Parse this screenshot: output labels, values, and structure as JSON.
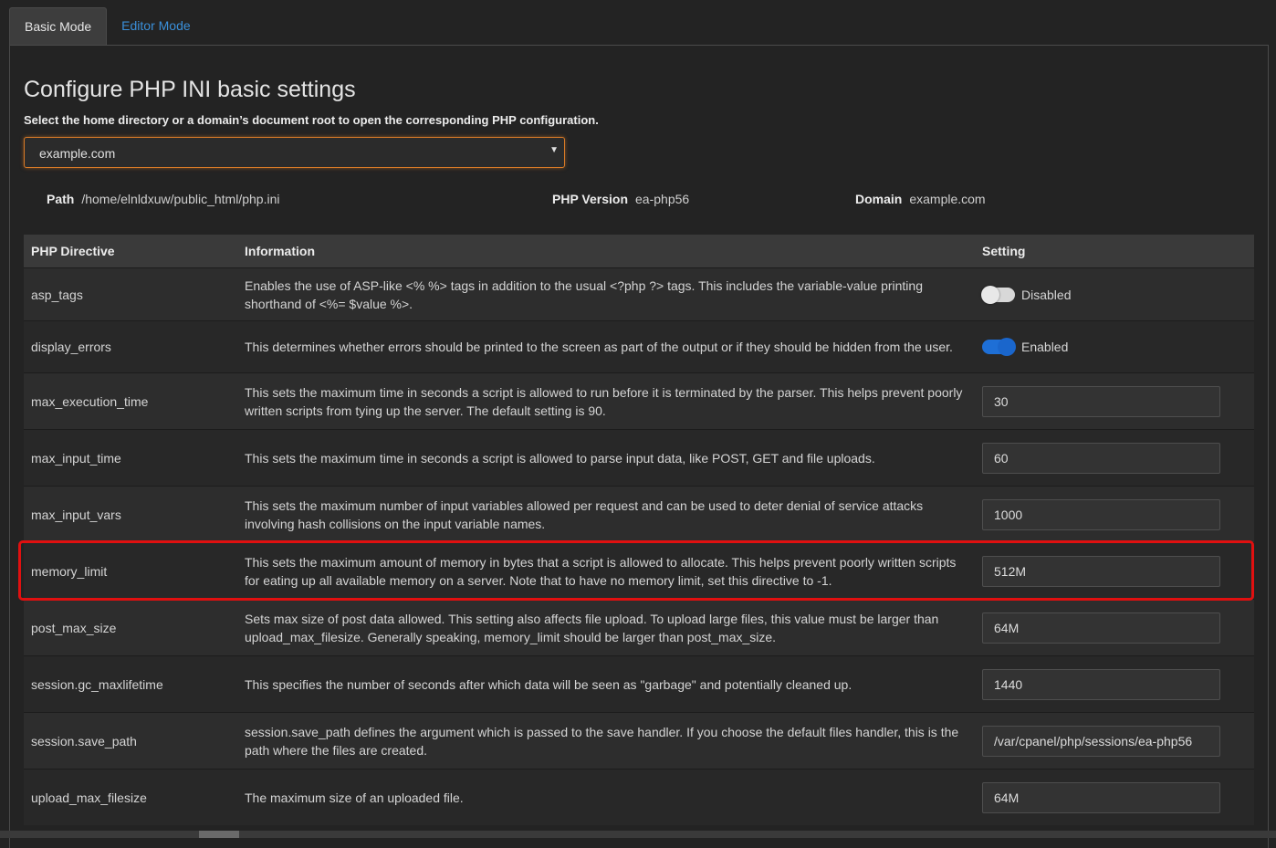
{
  "tabs": [
    {
      "label": "Basic Mode",
      "active": true
    },
    {
      "label": "Editor Mode",
      "active": false
    }
  ],
  "page": {
    "title": "Configure PHP INI basic settings",
    "subtitle": "Select the home directory or a domain’s document root to open the corresponding PHP configuration."
  },
  "domain_select": {
    "value": "example.com"
  },
  "meta": {
    "path_label": "Path",
    "path_value": "/home/elnldxuw/public_html/php.ini",
    "version_label": "PHP Version",
    "version_value": "ea-php56",
    "domain_label": "Domain",
    "domain_value": "example.com"
  },
  "table": {
    "headers": [
      "PHP Directive",
      "Information",
      "Setting"
    ],
    "rows": [
      {
        "directive": "asp_tags",
        "info": "Enables the use of ASP-like <% %> tags in addition to the usual <?php ?> tags. This includes the variable-value printing shorthand of <%= $value %>.",
        "type": "toggle",
        "state": "off",
        "value": "Disabled"
      },
      {
        "directive": "display_errors",
        "info": "This determines whether errors should be printed to the screen as part of the output or if they should be hidden from the user.",
        "type": "toggle",
        "state": "on",
        "value": "Enabled"
      },
      {
        "directive": "max_execution_time",
        "info": "This sets the maximum time in seconds a script is allowed to run before it is terminated by the parser. This helps prevent poorly written scripts from tying up the server. The default setting is 90.",
        "type": "input",
        "value": "30"
      },
      {
        "directive": "max_input_time",
        "info": "This sets the maximum time in seconds a script is allowed to parse input data, like POST, GET and file uploads.",
        "type": "input",
        "value": "60"
      },
      {
        "directive": "max_input_vars",
        "info": "This sets the maximum number of input variables allowed per request and can be used to deter denial of service attacks involving hash collisions on the input variable names.",
        "type": "input",
        "value": "1000"
      },
      {
        "directive": "memory_limit",
        "info": "This sets the maximum amount of memory in bytes that a script is allowed to allocate. This helps prevent poorly written scripts for eating up all available memory on a server. Note that to have no memory limit, set this directive to -1.",
        "type": "input",
        "value": "512M"
      },
      {
        "directive": "post_max_size",
        "info": "Sets max size of post data allowed. This setting also affects file upload. To upload large files, this value must be larger than upload_max_filesize. Generally speaking, memory_limit should be larger than post_max_size.",
        "type": "input",
        "value": "64M"
      },
      {
        "directive": "session.gc_maxlifetime",
        "info": "This specifies the number of seconds after which data will be seen as \"garbage\" and potentially cleaned up.",
        "type": "input",
        "value": "1440"
      },
      {
        "directive": "session.save_path",
        "info": "session.save_path defines the argument which is passed to the save handler. If you choose the default files handler, this is the path where the files are created.",
        "type": "input",
        "value": "/var/cpanel/php/sessions/ea-php56"
      },
      {
        "directive": "upload_max_filesize",
        "info": "The maximum size of an uploaded file.",
        "type": "input",
        "value": "64M"
      }
    ]
  }
}
